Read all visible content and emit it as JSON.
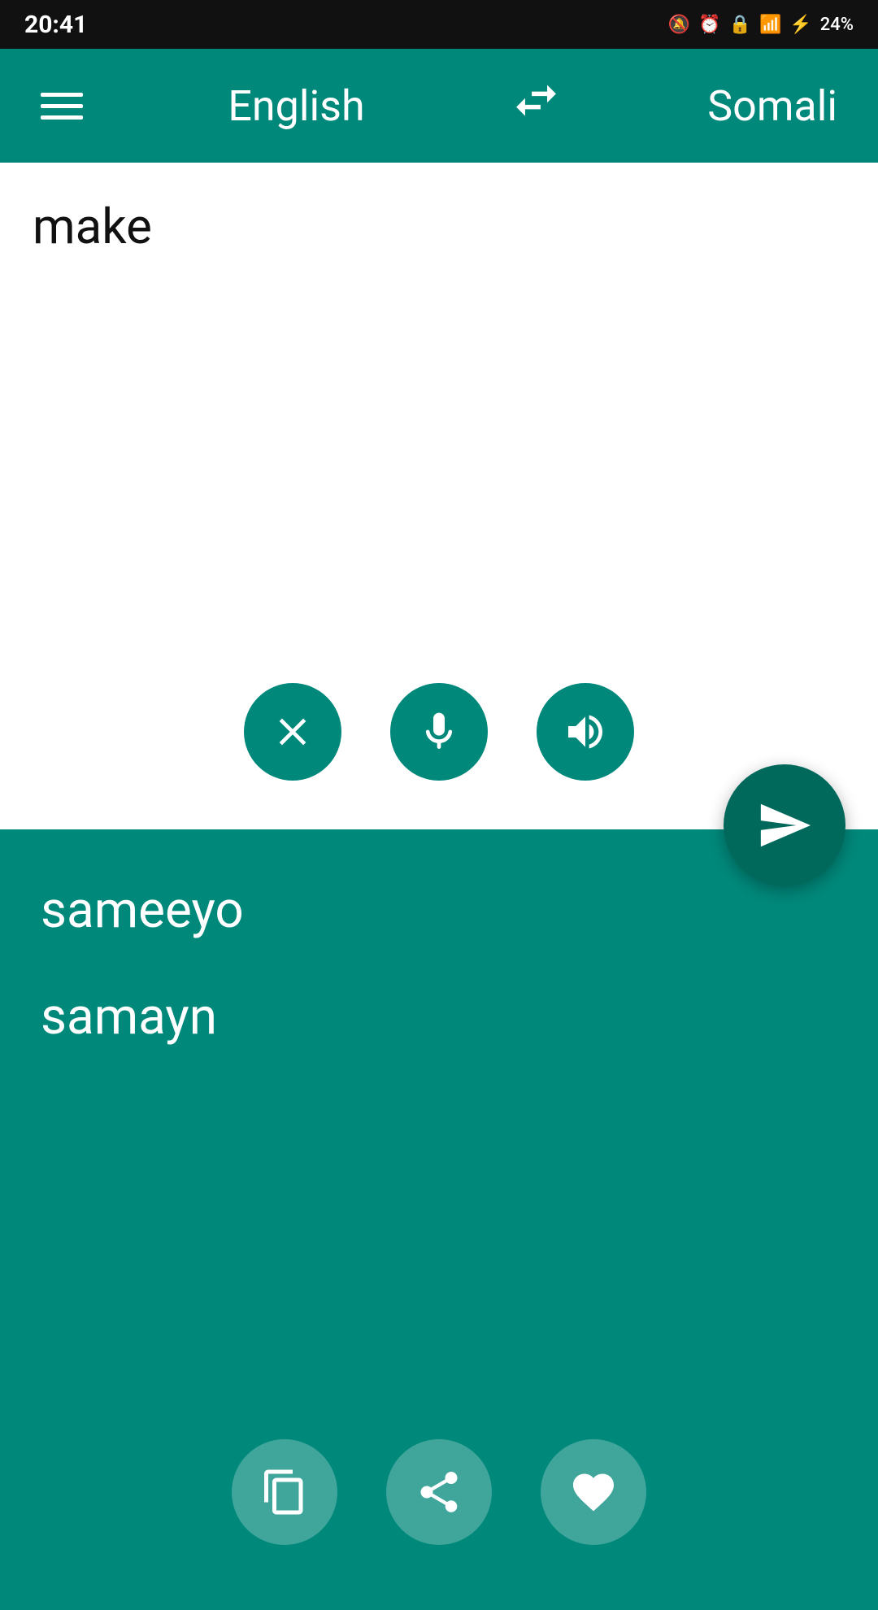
{
  "statusBar": {
    "time": "20:41",
    "batteryPercent": "24%"
  },
  "navBar": {
    "sourceLang": "English",
    "targetLang": "Somali",
    "swapLabel": "⇄"
  },
  "inputSection": {
    "inputText": "make",
    "clearLabel": "×",
    "micLabel": "mic",
    "speakerLabel": "speaker"
  },
  "resultSection": {
    "translations": [
      "sameeyo",
      "samayn"
    ]
  },
  "bottomActions": {
    "copyLabel": "copy",
    "shareLabel": "share",
    "favoriteLabel": "favorite"
  }
}
